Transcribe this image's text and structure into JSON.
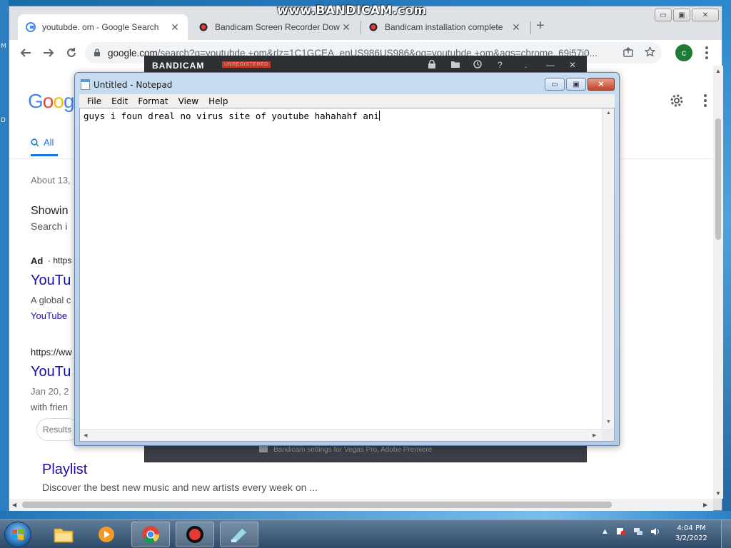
{
  "watermark": "www.BANDICAM.com",
  "desktop": {
    "left_glyphs": [
      "M",
      "D"
    ]
  },
  "chrome": {
    "tabs": [
      {
        "title": "youtubde. om - Google Search",
        "close": "✕",
        "favicon": "google-g-icon"
      },
      {
        "title": "Bandicam Screen Recorder Dow",
        "close": "✕",
        "favicon": "bandicam-record-icon"
      },
      {
        "title": "Bandicam installation complete",
        "close": "✕",
        "favicon": "bandicam-record-icon"
      }
    ],
    "new_tab": "+",
    "window_controls": {
      "minimize": "▭",
      "maximize": "▣",
      "close": "✕"
    },
    "address_host": "google.com",
    "address_rest": "/search?q=youtubde.+om&rlz=1C1GCEA_enUS986US986&oq=youtubde.+om&aqs=chrome..69i57j0...",
    "profile_initial": "c"
  },
  "google": {
    "logo": {
      "g": "G",
      "o1": "o",
      "o2": "o",
      "g2": "g"
    },
    "tab_all": "All",
    "about": "About 13,",
    "showing": "Showin",
    "search_instead": "Search i",
    "ad_label": "Ad",
    "ad_url": "· https",
    "result1_title": "YouTu",
    "result1_snippet": "A global c",
    "result1_link": "YouTube",
    "result2_url": "https://ww",
    "result2_title": "YouTu",
    "result2_date": "Jan 20, 2",
    "result2_snippet": "with frien",
    "chip": "Results",
    "playlist_title": "Playlist",
    "playlist_snippet": "Discover the best new music and new artists every week on ..."
  },
  "bandicam": {
    "logo": "BANDICAM",
    "unregistered": "UNREGISTERED",
    "toolbar_icons": [
      "lock-icon",
      "folder-icon",
      "clock-icon",
      "help-icon",
      "dots-icon",
      "minimize-icon",
      "close-icon"
    ],
    "toolbar_glyphs": {
      "help": "?",
      "dots": ".",
      "minimize": "—",
      "close": "✕"
    },
    "footer": "Bandicam settings for Vegas Pro, Adobe Premiere"
  },
  "notepad": {
    "title": "Untitled - Notepad",
    "menu": [
      "File",
      "Edit",
      "Format",
      "View",
      "Help"
    ],
    "content": "guys i foun dreal no virus site of youtube hahahahf ani",
    "controls": {
      "minimize": "▭",
      "maximize": "▣",
      "close": "✕"
    }
  },
  "taskbar": {
    "items": [
      "windows-explorer-icon",
      "media-player-icon",
      "chrome-icon",
      "bandicam-icon",
      "notepad-icon"
    ],
    "time": "4:04 PM",
    "date": "3/2/2022"
  }
}
